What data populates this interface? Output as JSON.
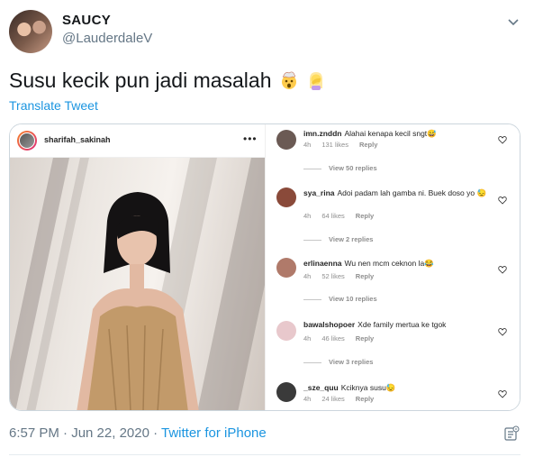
{
  "author": {
    "name": "SAUCY",
    "handle": "@LauderdaleV"
  },
  "tweet": {
    "text": "Susu kecik pun jadi masalah",
    "emojis": [
      "exploding-head-emoji",
      "woman-facepalming-emoji"
    ],
    "translate_label": "Translate Tweet"
  },
  "media": {
    "post_user": "sharifah_sakinah",
    "more_label": "•••",
    "comments": [
      {
        "user": "imn.znddn",
        "text": "Alahai kenapa kecil sngt😅",
        "age": "4h",
        "likes": "131 likes",
        "reply": "Reply",
        "view_replies": "View 50 replies",
        "avatar_color": "#6b5a54"
      },
      {
        "user": "sya_rina",
        "text": "Adoi padam lah gamba ni. Buek doso yo 😓",
        "age": "4h",
        "likes": "64 likes",
        "reply": "Reply",
        "view_replies": "View 2 replies",
        "avatar_color": "#8a4a3a"
      },
      {
        "user": "erlinaenna",
        "text": "Wu nen mcm ceknon la😂",
        "age": "4h",
        "likes": "52 likes",
        "reply": "Reply",
        "view_replies": "View 10 replies",
        "avatar_color": "#b07a6a"
      },
      {
        "user": "bawalshopoer",
        "text": "Xde family mertua ke tgok",
        "age": "4h",
        "likes": "46 likes",
        "reply": "Reply",
        "view_replies": "View 3 replies",
        "avatar_color": "#e8c8cc"
      },
      {
        "user": "_sze_quu",
        "text": "Kciknya susu😓",
        "age": "4h",
        "likes": "24 likes",
        "reply": "Reply",
        "view_replies": "",
        "avatar_color": "#3a3a3a"
      }
    ]
  },
  "footer": {
    "time": "6:57 PM · Jun 22, 2020 · ",
    "source": "Twitter for iPhone"
  },
  "colors": {
    "link": "#1b95e0",
    "secondary_text": "#657786"
  }
}
